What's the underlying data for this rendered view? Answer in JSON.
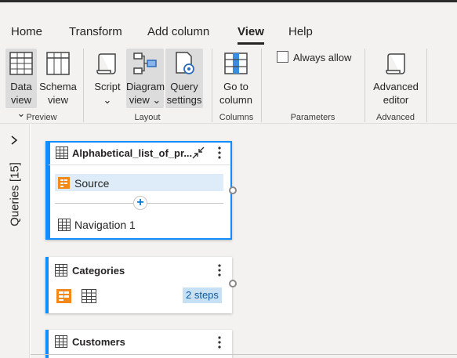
{
  "ribbon": {
    "tabs": [
      {
        "label": "Home"
      },
      {
        "label": "Transform"
      },
      {
        "label": "Add column"
      },
      {
        "label": "View"
      },
      {
        "label": "Help"
      }
    ],
    "buttons": {
      "data_view": {
        "line1": "Data",
        "line2": "view ⌄"
      },
      "schema_view": {
        "line1": "Schema",
        "line2": "view"
      },
      "script": {
        "line1": "Script",
        "line2": "⌄"
      },
      "diagram_view": {
        "line1": "Diagram",
        "line2": "view ⌄"
      },
      "query_settings": {
        "line1": "Query",
        "line2": "settings"
      },
      "go_to_column": {
        "line1": "Go to",
        "line2": "column"
      },
      "always_allow": {
        "label": "Always allow"
      },
      "advanced_editor": {
        "line1": "Advanced",
        "line2": "editor"
      }
    },
    "groups": {
      "preview": "Preview",
      "layout": "Layout",
      "columns": "Columns",
      "parameters": "Parameters",
      "advanced": "Advanced"
    }
  },
  "sidebar": {
    "label": "Queries [15]"
  },
  "diagram": {
    "cards": [
      {
        "title": "Alphabetical_list_of_pr...",
        "steps": [
          "Source",
          "Navigation 1"
        ]
      },
      {
        "title": "Categories",
        "badge": "2 steps"
      },
      {
        "title": "Customers"
      }
    ]
  },
  "colors": {
    "accent": "#118dff",
    "ribbon_bg": "#f3f2f1",
    "source_orange": "#f2891a"
  }
}
